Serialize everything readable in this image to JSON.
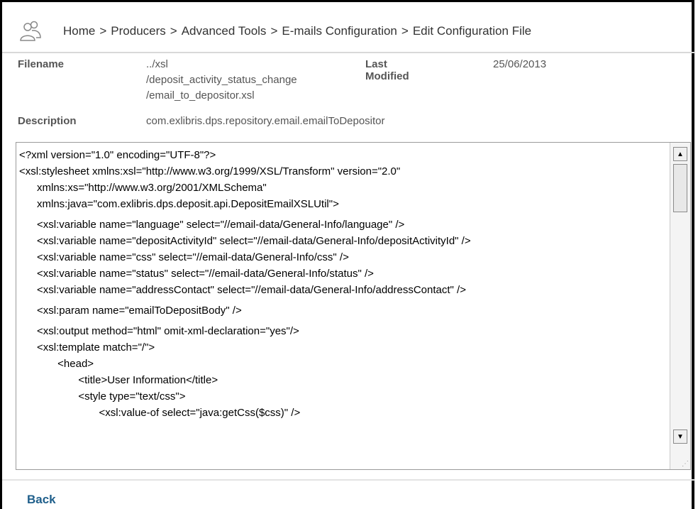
{
  "breadcrumb": {
    "items": [
      "Home",
      "Producers",
      "Advanced Tools",
      "E-mails Configuration",
      "Edit Configuration File"
    ],
    "separator": ">"
  },
  "meta": {
    "filename_label": "Filename",
    "filename_lines": [
      "../xsl",
      "/deposit_activity_status_change",
      "/email_to_depositor.xsl"
    ],
    "last_modified_label": "Last Modified",
    "last_modified_value": "25/06/2013",
    "description_label": "Description",
    "description_value": "com.exlibris.dps.repository.email.emailToDepositor"
  },
  "editor": {
    "lines": [
      "<?xml version=\"1.0\" encoding=\"UTF-8\"?>",
      "<xsl:stylesheet xmlns:xsl=\"http://www.w3.org/1999/XSL/Transform\" version=\"2.0\"",
      "      xmlns:xs=\"http://www.w3.org/2001/XMLSchema\"",
      "      xmlns:java=\"com.exlibris.dps.deposit.api.DepositEmailXSLUtil\">",
      "",
      "      <xsl:variable name=\"language\" select=\"//email-data/General-Info/language\" />",
      "      <xsl:variable name=\"depositActivityId\" select=\"//email-data/General-Info/depositActivityId\" />",
      "      <xsl:variable name=\"css\" select=\"//email-data/General-Info/css\" />",
      "      <xsl:variable name=\"status\" select=\"//email-data/General-Info/status\" />",
      "      <xsl:variable name=\"addressContact\" select=\"//email-data/General-Info/addressContact\" />",
      "",
      "      <xsl:param name=\"emailToDepositBody\" />",
      "",
      "      <xsl:output method=\"html\" omit-xml-declaration=\"yes\"/>",
      "      <xsl:template match=\"/\">",
      "             <head>",
      "                    <title>User Information</title>",
      "                    <style type=\"text/css\">",
      "                           <xsl:value-of select=\"java:getCss($css)\" />"
    ]
  },
  "footer": {
    "back_label": "Back"
  },
  "icons": {
    "header_icon": "users-icon",
    "scroll_up": "arrow-up-icon",
    "scroll_down": "arrow-down-icon",
    "resize": "resize-grip-icon"
  },
  "colors": {
    "link": "#1f5f8b",
    "text": "#333333"
  }
}
